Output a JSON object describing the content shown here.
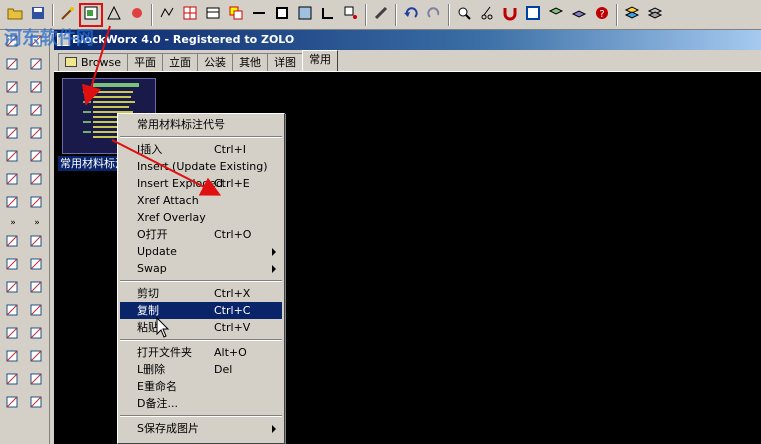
{
  "window": {
    "title": "BlockWorx 4.0 - Registered to ZOLO"
  },
  "watermark": "河东软件网",
  "toolbar_icons": [
    "folder-icon",
    "save-icon",
    "wand-icon",
    "insert-block-icon",
    "draw-icon",
    "star-icon",
    "polyline-icon",
    "grid-icon",
    "table-icon",
    "copy-icon",
    "line-icon",
    "box-icon",
    "panel-icon",
    "corner-icon",
    "select-icon",
    "pencil-icon",
    "undo-icon",
    "redo-icon",
    "zoom-icon",
    "cut-icon",
    "magnet-icon",
    "window-icon",
    "layers-icon",
    "stack-icon",
    "help-icon",
    "layer-manager-icon",
    "layer-stack-icon"
  ],
  "tabs": [
    {
      "label": "Browse",
      "active": false
    },
    {
      "label": "平面",
      "active": false
    },
    {
      "label": "立面",
      "active": false
    },
    {
      "label": "公装",
      "active": false
    },
    {
      "label": "其他",
      "active": false
    },
    {
      "label": "详图",
      "active": false
    },
    {
      "label": "常用",
      "active": true
    }
  ],
  "thumbnail": {
    "label": "常用材料标注代号"
  },
  "context_menu": {
    "items": [
      {
        "type": "item",
        "label": "常用材料标注代号",
        "shortcut": ""
      },
      {
        "type": "separator"
      },
      {
        "type": "item",
        "label": "I插入",
        "shortcut": "Ctrl+I"
      },
      {
        "type": "item",
        "label": "Insert (Update Existing)",
        "shortcut": ""
      },
      {
        "type": "item",
        "label": "Insert Exploded",
        "shortcut": "Ctrl+E"
      },
      {
        "type": "item",
        "label": "Xref Attach",
        "shortcut": ""
      },
      {
        "type": "item",
        "label": "Xref Overlay",
        "shortcut": ""
      },
      {
        "type": "item",
        "label": "O打开",
        "shortcut": "Ctrl+O"
      },
      {
        "type": "item",
        "label": "Update",
        "shortcut": "",
        "submenu": true
      },
      {
        "type": "item",
        "label": "Swap",
        "shortcut": "",
        "submenu": true
      },
      {
        "type": "separator"
      },
      {
        "type": "item",
        "label": "剪切",
        "shortcut": "Ctrl+X"
      },
      {
        "type": "item",
        "label": "复制",
        "shortcut": "Ctrl+C",
        "selected": true
      },
      {
        "type": "item",
        "label": "粘贴",
        "shortcut": "Ctrl+V"
      },
      {
        "type": "separator"
      },
      {
        "type": "item",
        "label": "打开文件夹",
        "shortcut": "Alt+O"
      },
      {
        "type": "item",
        "label": "L删除",
        "shortcut": "Del"
      },
      {
        "type": "item",
        "label": "E重命名",
        "shortcut": ""
      },
      {
        "type": "item",
        "label": "D备注...",
        "shortcut": ""
      },
      {
        "type": "separator"
      },
      {
        "type": "item",
        "label": "S保存成图片",
        "shortcut": "",
        "submenu": true
      }
    ]
  },
  "colors": {
    "selection": "#0a246a",
    "annotation": "#e01010",
    "face": "#d4d0c8"
  }
}
